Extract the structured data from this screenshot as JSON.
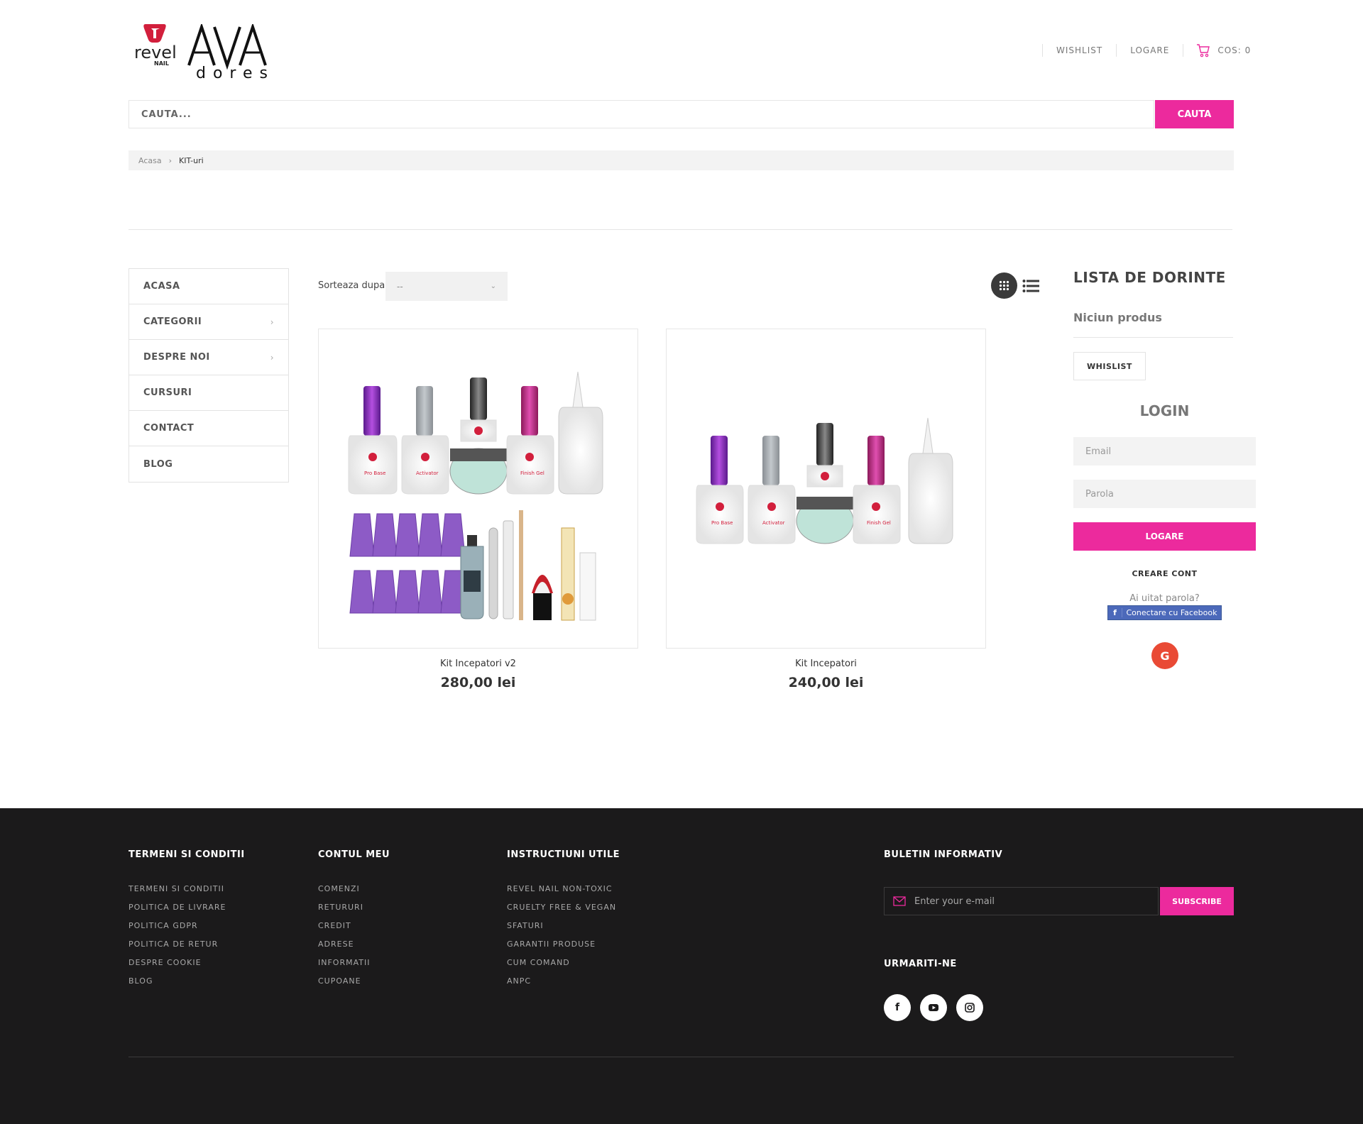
{
  "header": {
    "logo_revel_text": "revel NAIL",
    "logo_ava_text": "AVA dores",
    "links": [
      "WISHLIST",
      "LOGARE"
    ],
    "cart_label": "COS: 0"
  },
  "search": {
    "placeholder": "CAUTA...",
    "button": "CAUTA"
  },
  "breadcrumb": {
    "home": "Acasa",
    "sep": "›",
    "current": "KIT-uri"
  },
  "leftnav": {
    "items": [
      {
        "label": "ACASA",
        "has_children": false
      },
      {
        "label": "CATEGORII",
        "has_children": true
      },
      {
        "label": "DESPRE NOI",
        "has_children": true
      },
      {
        "label": "CURSURI",
        "has_children": false
      },
      {
        "label": "CONTACT",
        "has_children": false
      },
      {
        "label": "BLOG",
        "has_children": false
      }
    ]
  },
  "toolbar": {
    "sort_label": "Sorteaza dupa",
    "sort_value": "--"
  },
  "products": [
    {
      "name": "Kit Incepatori v2",
      "price": "280,00 lei"
    },
    {
      "name": "Kit Incepatori",
      "price": "240,00 lei"
    }
  ],
  "wishlist": {
    "title": "LISTA DE DORINTE",
    "empty": "Niciun produs",
    "button": "WHISLIST"
  },
  "login": {
    "title": "LOGIN",
    "email_placeholder": "Email",
    "password_placeholder": "Parola",
    "button": "LOGARE",
    "create": "CREARE CONT",
    "forgot": "Ai uitat parola?",
    "facebook": "Conectare cu Facebook",
    "google": "G"
  },
  "footer": {
    "columns": [
      {
        "title": "TERMENI SI CONDITII",
        "items": [
          "TERMENI SI CONDITII",
          "POLITICA DE LIVRARE",
          "POLITICA GDPR",
          "POLITICA DE RETUR",
          "DESPRE COOKIE",
          "BLOG"
        ]
      },
      {
        "title": "CONTUL MEU",
        "items": [
          "COMENZI",
          "RETURURI",
          "CREDIT",
          "ADRESE",
          "INFORMATII",
          "CUPOANE"
        ]
      },
      {
        "title": "INSTRUCTIUNI UTILE",
        "items": [
          "REVEL NAIL NON-TOXIC",
          "CRUELTY FREE & VEGAN",
          "SFATURI",
          "GARANTII PRODUSE",
          "CUM COMAND",
          "ANPC"
        ]
      }
    ],
    "newsletter": {
      "title": "BULETIN INFORMATIV",
      "placeholder": "Enter your e-mail",
      "button": "SUBSCRIBE"
    },
    "follow": {
      "title": "URMARITI-NE",
      "icons": [
        "facebook-icon",
        "youtube-icon",
        "instagram-icon"
      ]
    }
  },
  "colors": {
    "accent": "#ec2a9d",
    "footer_bg": "#1b1a1b",
    "brand_red": "#d21f3c",
    "facebook": "#4c69ba",
    "google": "#e94a35"
  }
}
